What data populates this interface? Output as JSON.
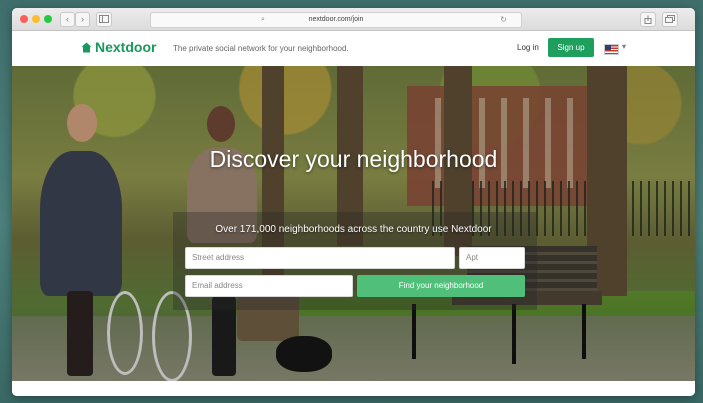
{
  "browser": {
    "url": "nextdoor.com/join",
    "nav_back": "‹",
    "nav_forward": "›",
    "search_glyph": "⌕",
    "reload_glyph": "↻"
  },
  "header": {
    "brand": "Nextdoor",
    "tagline": "The private social network for your neighborhood.",
    "login": "Log in",
    "signup": "Sign up",
    "flag_chevron": "▾"
  },
  "hero": {
    "title": "Discover your neighborhood",
    "subtitle": "Over 171,000 neighborhoods across the country use Nextdoor",
    "street_placeholder": "Street address",
    "apt_placeholder": "Apt",
    "email_placeholder": "Email address",
    "find_button": "Find your neighborhood"
  },
  "colors": {
    "brand_green": "#19975d",
    "signup_green": "#1e9f5e",
    "find_button_green": "#4fbf7a"
  },
  "icons": [
    "close-dot",
    "minimize-dot",
    "zoom-dot",
    "back-icon",
    "forward-icon",
    "sidebar-icon",
    "search-icon",
    "reload-icon",
    "share-icon",
    "tabs-icon",
    "house-logo-icon",
    "us-flag-icon",
    "chevron-down-icon"
  ]
}
